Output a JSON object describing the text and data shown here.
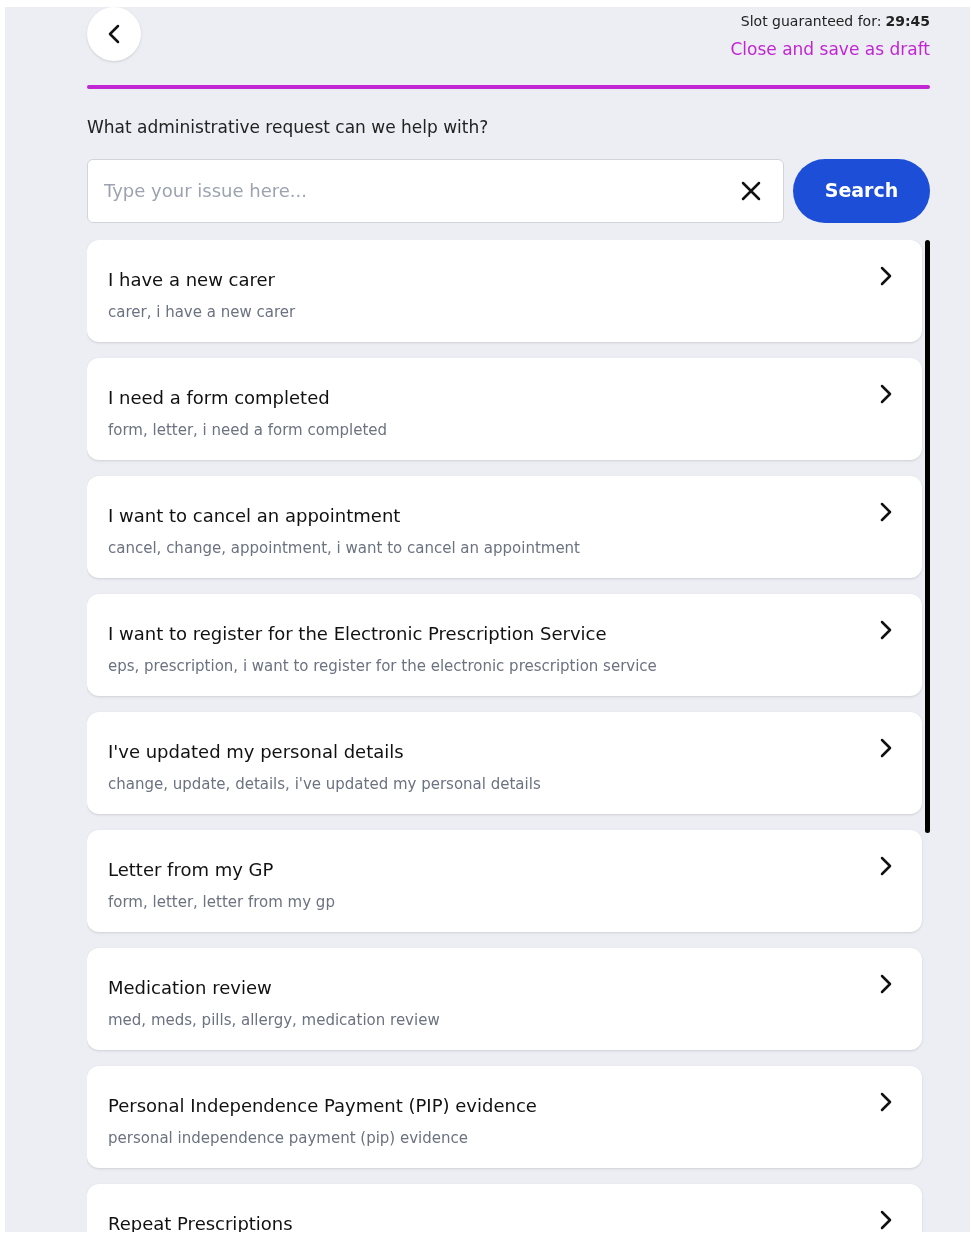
{
  "header": {
    "slot_label": "Slot guaranteed for:",
    "slot_time": "29:45",
    "close_link": "Close and save as draft",
    "progress": {
      "level": 1
    }
  },
  "question": "What administrative request can we help with?",
  "search": {
    "placeholder": "Type your issue here...",
    "button": "Search"
  },
  "requests": [
    {
      "title": "I have a new carer",
      "keywords": "carer, i have a new carer"
    },
    {
      "title": "I need a form completed",
      "keywords": "form, letter, i need a form completed"
    },
    {
      "title": "I want to cancel an appointment",
      "keywords": "cancel, change, appointment, i want to cancel an appointment"
    },
    {
      "title": "I want to register for the Electronic Prescription Service",
      "keywords": "eps, prescription, i want to register for the electronic prescription service"
    },
    {
      "title": "I've updated my personal details",
      "keywords": "change, update, details, i've updated my personal details"
    },
    {
      "title": "Letter from my GP",
      "keywords": "form, letter, letter from my gp"
    },
    {
      "title": "Medication review",
      "keywords": "med, meds, pills, allergy, medication review"
    },
    {
      "title": "Personal Independence Payment (PIP) evidence",
      "keywords": "personal independence payment (pip) evidence"
    },
    {
      "title": "Repeat Prescriptions"
    }
  ]
}
